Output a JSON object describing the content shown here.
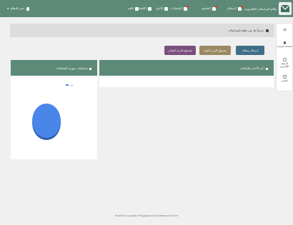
{
  "topbar": {
    "system_name": "نظام المراسلات الإلكترونية",
    "nav": [
      {
        "label": "الرسائل",
        "icon": "envelope-icon",
        "badge": true
      },
      {
        "label": "التعاميم",
        "icon": "document-icon",
        "badge": true
      },
      {
        "label": "الإشعارات",
        "icon": "bell-icon",
        "badge": true
      },
      {
        "label": "الأدوار",
        "icon": "roles-icon",
        "badge": false
      },
      {
        "label": "الأقسام",
        "icon": "building-icon",
        "badge": false
      },
      {
        "label": "اللغة",
        "icon": "language-icon",
        "badge": false
      }
    ],
    "user": "مدير النظام"
  },
  "sidebar": {
    "items": [
      {
        "label": "",
        "icon": "circle-icon"
      },
      {
        "label": "الصفحة الرئيسية",
        "icon": "home-icon"
      },
      {
        "label": "الأرشيف الإلكتروني",
        "icon": "archive-icon"
      },
      {
        "label": "التقارير",
        "icon": "reports-icon"
      }
    ]
  },
  "welcome": {
    "text": "مرحباً بك في نظام المراسلات"
  },
  "buttons": {
    "send": "إرسال رسالة",
    "inbox": "صندوق البريد الوارد",
    "sent": "صندوق البريد الصادر"
  },
  "news_panel": {
    "title": "آخر الأخبار والإعلانات"
  },
  "stats_panel": {
    "title": "إحصائيات شهرية للمعاملات",
    "legend": "وارد"
  },
  "chart_data": {
    "type": "pie",
    "series": [
      {
        "name": "وارد",
        "values": [
          100
        ]
      }
    ],
    "colors": [
      "#4a86e8"
    ]
  },
  "footer": {
    "text": "All Works Copyright of Mugeetee Group Otherwise ©",
    "link": "2024"
  }
}
